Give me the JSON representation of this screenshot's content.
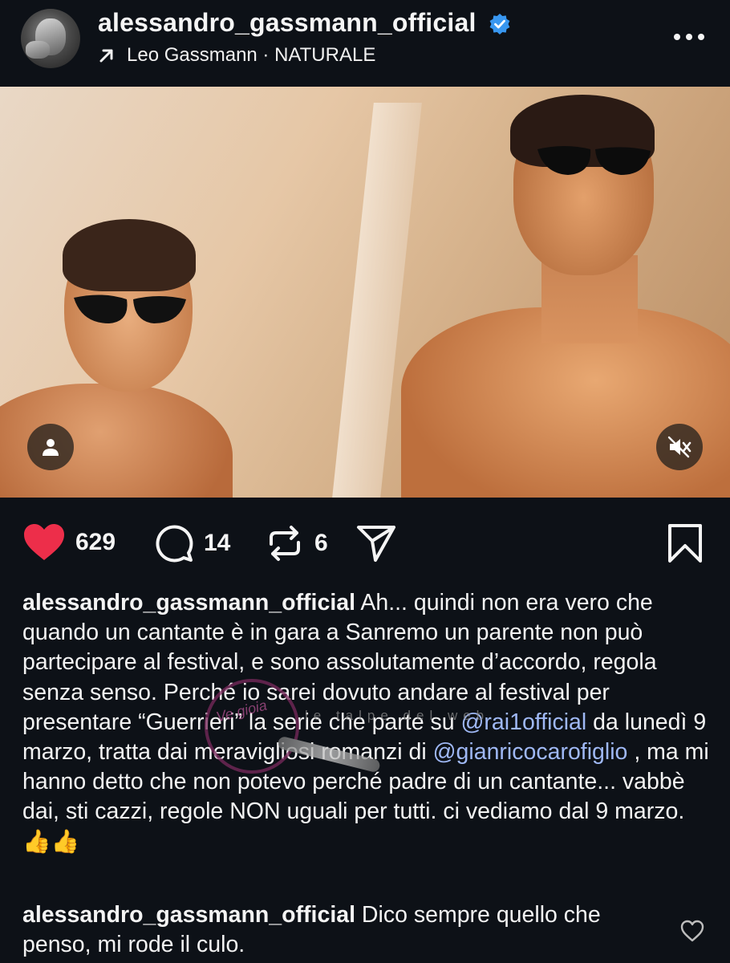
{
  "header": {
    "username": "alessandro_gassmann_official",
    "music": "Leo Gassmann · NATURALE",
    "avatar": "profile-photo"
  },
  "photo": {
    "description_icons": [
      "user-tag-icon",
      "mute-icon"
    ]
  },
  "actions": {
    "likes": "629",
    "comments": "14",
    "reposts": "6"
  },
  "caption": {
    "username": "alessandro_gassmann_official",
    "text_part1": " Ah... quindi non era vero che quando un cantante è in gara a Sanremo un parente non può partecipare al festival, e sono assolutamente d’accordo, regola senza senso. Perché io sarei dovuto andare al festival per presentare “Guerrieri” la serie che parte su ",
    "mention1": "@rai1official",
    "text_part2": " da lunedì 9 marzo, tratta dai meravigliosi romanzi di ",
    "mention2": "@gianricocarofiglio",
    "text_part3": " , ma mi hanno detto che non potevo perché padre di un cantante... vabbè dai, sti cazzi, regole NON uguali per tutti. ci vediamo dal 9 marzo. 👍👍"
  },
  "comment": {
    "username": "alessandro_gassmann_official",
    "text": " Dico sempre quello che penso, mi rode il culo."
  },
  "colors": {
    "background": "#0d1117",
    "like_red": "#ed2e4a",
    "verified_blue": "#3897f0",
    "mention": "#9fb8f5"
  }
}
